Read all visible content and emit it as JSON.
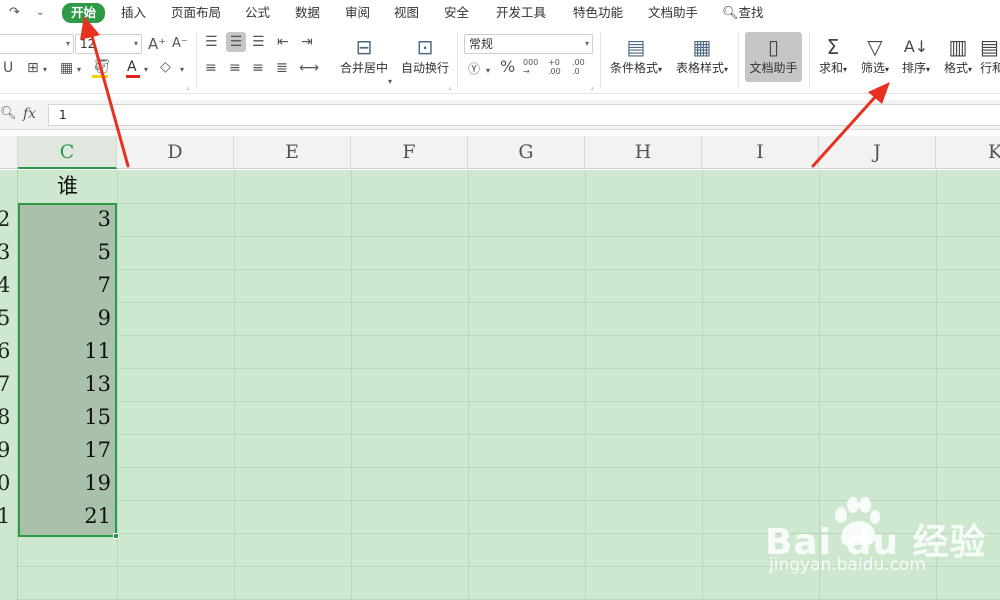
{
  "menubar": {
    "items": [
      {
        "label": "开始",
        "active": true
      },
      {
        "label": "插入"
      },
      {
        "label": "页面布局"
      },
      {
        "label": "公式"
      },
      {
        "label": "数据"
      },
      {
        "label": "审阅"
      },
      {
        "label": "视图"
      },
      {
        "label": "安全"
      },
      {
        "label": "开发工具"
      },
      {
        "label": "特色功能"
      },
      {
        "label": "文档助手"
      }
    ],
    "search_label": "查找"
  },
  "ribbon": {
    "font_size": "12",
    "number_format": "常规",
    "merge_label": "合并居中",
    "wrap_label": "自动换行",
    "conditional_label": "条件格式",
    "table_style_label": "表格样式",
    "doc_helper_label": "文档助手",
    "sum_label": "求和",
    "filter_label": "筛选",
    "sort_label": "排序",
    "format_label": "格式",
    "row_col_label": "行和"
  },
  "formula": {
    "fx_label": "fx",
    "value": "1"
  },
  "columns": [
    "C",
    "D",
    "E",
    "F",
    "G",
    "H",
    "I",
    "J",
    "K"
  ],
  "rows": {
    "headers": [
      "",
      "2",
      "3",
      "4",
      "5",
      "6",
      "7",
      "8",
      "9",
      "0",
      "1"
    ],
    "c_values": [
      "谁",
      "3",
      "5",
      "7",
      "9",
      "11",
      "13",
      "15",
      "17",
      "19",
      "21"
    ]
  },
  "colors": {
    "accent": "#2e9a45",
    "grid_bg": "#cde8cf",
    "selection_bg": "#a9c1aa",
    "arrow": "#e8311f"
  },
  "watermark": {
    "text": "Bai du 经验",
    "sub": "jingyan.baidu.com"
  }
}
